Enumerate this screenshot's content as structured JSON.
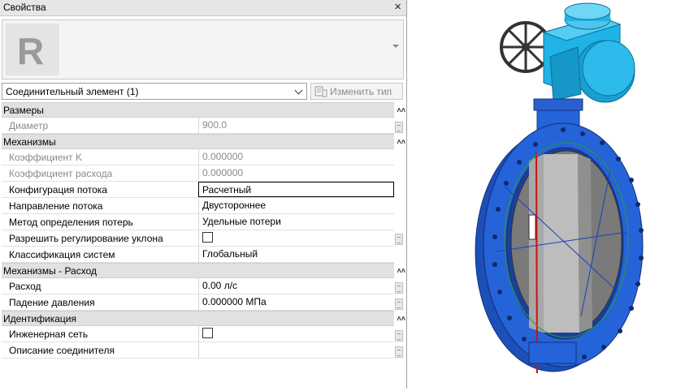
{
  "palette": {
    "title": "Свойства",
    "close_icon": "×",
    "logo_letter": "R",
    "type_selector": "Соединительный элемент (1)",
    "edit_type_label": "Изменить тип",
    "sections": [
      {
        "name": "Размеры",
        "rows": [
          {
            "label": "Диаметр",
            "value": "900.0",
            "disabled": true
          }
        ]
      },
      {
        "name": "Механизмы",
        "rows": [
          {
            "label": "Коэффициент K",
            "value": "0.000000",
            "disabled": true
          },
          {
            "label": "Коэффициент расхода",
            "value": "0.000000",
            "disabled": true
          },
          {
            "label": "Конфигурация потока",
            "value": "Расчетный",
            "focused": true
          },
          {
            "label": "Направление потока",
            "value": "Двустороннее"
          },
          {
            "label": "Метод определения потерь",
            "value": "Удельные потери"
          },
          {
            "label": "Разрешить регулирование уклона",
            "value": "",
            "checkbox": true
          },
          {
            "label": "Классификация систем",
            "value": "Глобальный"
          }
        ]
      },
      {
        "name": "Механизмы - Расход",
        "rows": [
          {
            "label": "Расход",
            "value": "0.00 л/с"
          },
          {
            "label": "Падение давления",
            "value": "0.000000 МПа"
          }
        ]
      },
      {
        "name": "Идентификация",
        "rows": [
          {
            "label": "Инженерная сеть",
            "value": "",
            "checkbox": true
          },
          {
            "label": "Описание соединителя",
            "value": ""
          }
        ]
      }
    ]
  },
  "colors": {
    "valve_blue": "#2563d9",
    "actuator_cyan": "#1fb3e6",
    "section_bg": "#e1e1e1",
    "disc_grey": "#8f8f8f"
  }
}
